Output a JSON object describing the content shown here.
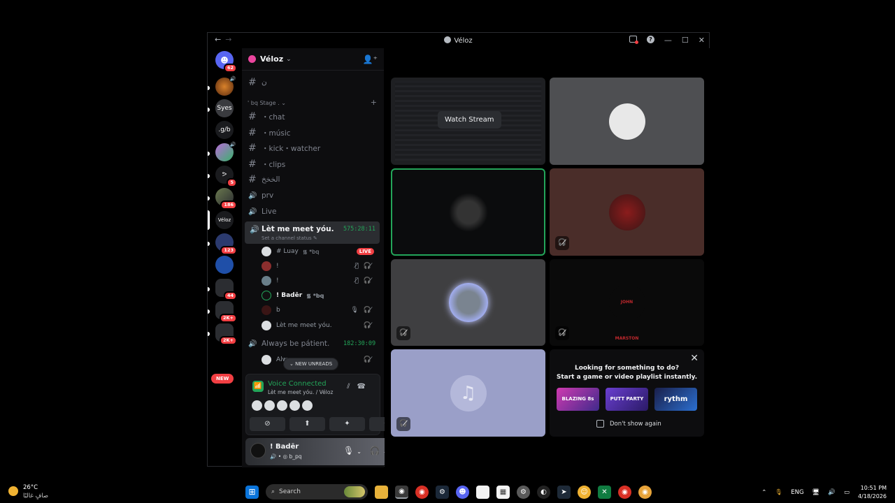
{
  "window": {
    "title": "Véloz",
    "back": "←",
    "forward": "→",
    "inbox_icon": "inbox-icon",
    "help": "?",
    "minimize": "—",
    "maximize": "☐",
    "close": "✕"
  },
  "rail": {
    "servers": [
      {
        "label": "",
        "badge": "62"
      },
      {
        "label": "",
        "badge": ""
      },
      {
        "label": "Syes",
        "badge": ""
      },
      {
        "label": ".g/b",
        "badge": ""
      },
      {
        "label": "",
        "badge": ""
      },
      {
        "label": "ᕗ",
        "badge": "5"
      },
      {
        "label": "",
        "badge": "186"
      },
      {
        "label": "Véloz",
        "badge": ""
      },
      {
        "label": "",
        "badge": "123"
      },
      {
        "label": "",
        "badge": ""
      },
      {
        "label": "",
        "badge": "44"
      },
      {
        "label": "",
        "badge": "2K+"
      },
      {
        "label": "",
        "badge": "2K+"
      }
    ],
    "new_label": "NEW"
  },
  "guild": {
    "name": "Véloz",
    "chevron": "⌄"
  },
  "channels": {
    "top": {
      "name": "ن"
    },
    "category": "' bq Stage . ⌄",
    "text": [
      {
        "name": "・chat"
      },
      {
        "name": "・músic"
      },
      {
        "name": "・kick・watcher"
      },
      {
        "name": "・clips"
      },
      {
        "name": "الخخخ"
      }
    ],
    "voice": [
      {
        "name": "prv"
      },
      {
        "name": "Live"
      }
    ],
    "active_voice": {
      "name": "Lèt me meet yóu.",
      "timer": "575:28:11",
      "status": "Set a channel status ✎"
    },
    "members": [
      {
        "name": "# Luay",
        "tag": "᯾ *bq",
        "flags": "",
        "live": "LIVE"
      },
      {
        "name": "!",
        "tag": "",
        "flags": "🎙̸ 🎧̸",
        "live": ""
      },
      {
        "name": "!",
        "tag": "",
        "flags": "🎙̸ 🎧̸",
        "live": ""
      },
      {
        "name": "! Badēr",
        "tag": "᯾ *bq",
        "flags": "",
        "live": ""
      },
      {
        "name": "b",
        "tag": "",
        "flags": "🎙 🎧̸",
        "live": ""
      },
      {
        "name": "Lèt me meet yóu.",
        "tag": "",
        "flags": "🎧̸",
        "live": ""
      }
    ],
    "second_voice": {
      "name": "Always be pátient.",
      "timer": "182:30:09"
    },
    "second_member": {
      "name": "Alw",
      "flags": "🎧̸"
    },
    "new_unreads": "⌄ NEW UNREADS"
  },
  "voice_panel": {
    "status": "Voice Connected",
    "location": "Lèt me meet yóu. / Véloz",
    "buttons": [
      "⊘",
      "⬆",
      "✦",
      "✺"
    ]
  },
  "user": {
    "name": "! Badēr",
    "status": "🔊 • ◎ b_pq"
  },
  "stage": {
    "watch_stream": "Watch Stream",
    "tiles": [
      {
        "kind": "stream",
        "bg": "#1e1f22"
      },
      {
        "kind": "avatar",
        "bg": "#4e4f52"
      },
      {
        "kind": "avatar",
        "bg": "#0b0c0d",
        "speaking": true
      },
      {
        "kind": "avatar",
        "bg": "#4a2d29"
      },
      {
        "kind": "avatar",
        "bg": "#3f3f41"
      },
      {
        "kind": "avatar",
        "bg": "#0a0a0a"
      },
      {
        "kind": "avatar",
        "bg": "#9a9fc8"
      }
    ]
  },
  "activity": {
    "line1": "Looking for something to do?",
    "line2": "Start a game or video playlist instantly.",
    "apps": [
      "BLAZING 8s",
      "PUTT PARTY",
      "rythm"
    ],
    "dont_show": "Don't show again"
  },
  "taskbar": {
    "temp": "26°C",
    "condition": "صافٍ غالبًا",
    "search": "Search",
    "lang": "ENG",
    "time": "10:51 PM",
    "date": "4/18/2026"
  }
}
